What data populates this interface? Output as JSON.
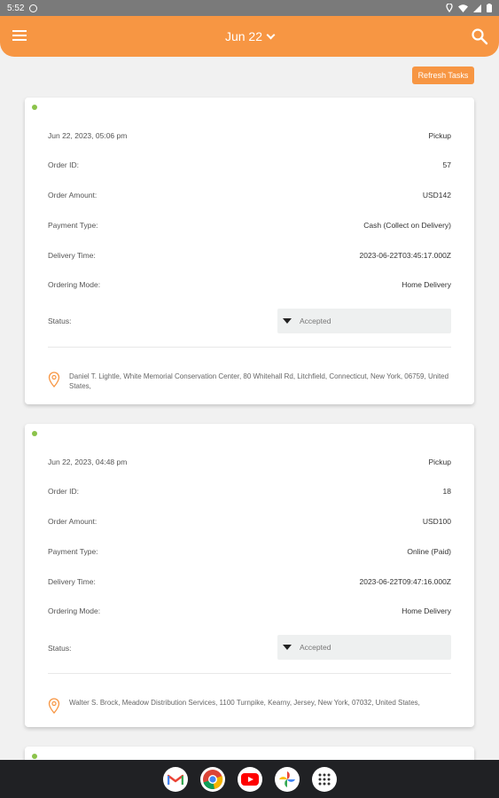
{
  "status_bar": {
    "time": "5:52"
  },
  "header": {
    "title": "Jun 22"
  },
  "actions": {
    "refresh_label": "Refresh Tasks"
  },
  "labels": {
    "order_id": "Order ID:",
    "order_amount": "Order Amount:",
    "payment_type": "Payment Type:",
    "delivery_time": "Delivery Time:",
    "ordering_mode": "Ordering Mode:",
    "status": "Status:"
  },
  "orders": [
    {
      "date": "Jun 22, 2023, 05:06 pm",
      "type": "Pickup",
      "order_id": "57",
      "amount": "USD142",
      "payment": "Cash (Collect on Delivery)",
      "delivery_time": "2023-06-22T03:45:17.000Z",
      "mode": "Home Delivery",
      "status": "Accepted",
      "address": "Daniel T. Lightle, White Memorial Conservation Center, 80 Whitehall Rd, Litchfield, Connecticut, New York, 06759, United States,"
    },
    {
      "date": "Jun 22, 2023, 04:48 pm",
      "type": "Pickup",
      "order_id": "18",
      "amount": "USD100",
      "payment": "Online (Paid)",
      "delivery_time": "2023-06-22T09:47:16.000Z",
      "mode": "Home Delivery",
      "status": "Accepted",
      "address": "Walter S. Brock, Meadow Distribution Services, 1100 Turnpike, Kearny, Jersey, New York, 07032, United States,"
    }
  ],
  "colors": {
    "accent": "#f79643",
    "online_dot": "#8bc34a"
  },
  "dock": [
    "gmail-icon",
    "chrome-icon",
    "youtube-icon",
    "photos-icon",
    "apps-icon"
  ]
}
